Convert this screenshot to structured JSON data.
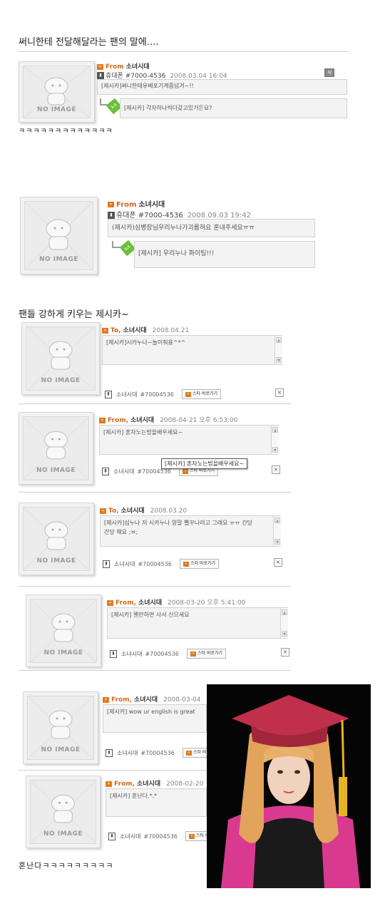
{
  "heading1": "써니한테 전달해달라는 팬의 말에....",
  "heading2": "팬들 강하게 키우는 제시카~",
  "laugh1": "ㅋㅋㅋㅋㅋㅋㅋㅋㅋㅋㅋㅋㅋ",
  "laugh2": "혼난다ㅋㅋㅋㅋㅋㅋㅋㅋㅋ",
  "no_image": "NO IMAGE",
  "reply_badge": "1:1",
  "card1": {
    "from_label": "From",
    "name": "소녀시대",
    "phone_label": "휴대폰",
    "phone": "#7000-4536",
    "date": "2008.03.04 16:04",
    "delete_label": "삭제",
    "message": "[제시카]써니한테유베포기게좀넘겨~!!",
    "reply": "[제시카] 각자하나씩다갖고있거든요?"
  },
  "card2": {
    "from_label": "From",
    "name": "소녀시대",
    "phone_label": "휴대폰",
    "phone": "#7000-4536",
    "date": "2008.09.03 19:42",
    "message": "(제시카)심병장님우리누나가괴롭혀요 혼내주세요ㅠㅠ",
    "reply": "[제시카] 우리누나 화이팅!!!"
  },
  "cards": [
    {
      "dir": "To,",
      "name": "소녀시대",
      "date": "2008.04.21",
      "message": "[제시카]시카누나~놀이줘용^*^",
      "message2": ""
    },
    {
      "dir": "From,",
      "name": "소녀시대",
      "date": "2008-04-21 오후 6:53:00",
      "message": "[제시카] 혼자노는법을배우세요~",
      "message2": ""
    },
    {
      "dir": "To,",
      "name": "소녀시대",
      "date": "2008.03.20",
      "message": "[제시카]심누나 저 시카누나 양말 빨꾸나려고 그래요 ㅠㅠ 간당",
      "message2": "간당 해요 ;ㅂ;"
    },
    {
      "dir": "From,",
      "name": "소녀시대",
      "date": "2008-03-20 오후 5:41:00",
      "message": "[제시카] 웬만하면 사서 신으세요",
      "message2": ""
    },
    {
      "dir": "From,",
      "name": "소녀시대",
      "date": "2008-03-04",
      "message": "[제시카] wow ur english is great",
      "message2": ""
    },
    {
      "dir": "From,",
      "name": "소녀시대",
      "date": "2008-02-20",
      "message": "[제시카] 혼난다.*.*",
      "message2": ""
    }
  ],
  "footer_name": "소녀시대",
  "footer_number": "#70004536",
  "star_button": "스타 바로가기",
  "close_symbol": "×",
  "tooltip": "[제시카] 혼자노는법을배우세요~",
  "colors": {
    "accent": "#e07a1f",
    "ribbon": "#6bbf3a",
    "graduation_cap": "#c0304a"
  }
}
